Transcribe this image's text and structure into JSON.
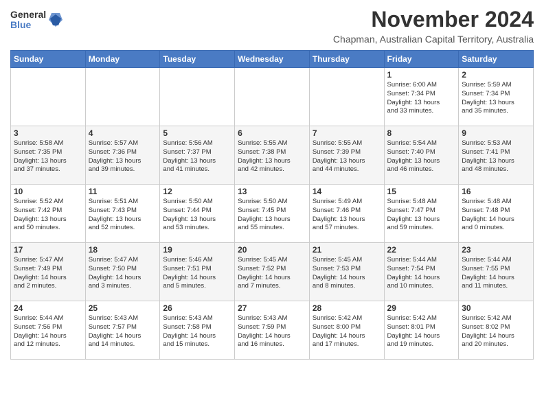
{
  "header": {
    "logo": {
      "general": "General",
      "blue": "Blue"
    },
    "title": "November 2024",
    "subtitle": "Chapman, Australian Capital Territory, Australia"
  },
  "weekdays": [
    "Sunday",
    "Monday",
    "Tuesday",
    "Wednesday",
    "Thursday",
    "Friday",
    "Saturday"
  ],
  "weeks": [
    [
      {
        "day": "",
        "info": ""
      },
      {
        "day": "",
        "info": ""
      },
      {
        "day": "",
        "info": ""
      },
      {
        "day": "",
        "info": ""
      },
      {
        "day": "",
        "info": ""
      },
      {
        "day": "1",
        "info": "Sunrise: 6:00 AM\nSunset: 7:34 PM\nDaylight: 13 hours\nand 33 minutes."
      },
      {
        "day": "2",
        "info": "Sunrise: 5:59 AM\nSunset: 7:34 PM\nDaylight: 13 hours\nand 35 minutes."
      }
    ],
    [
      {
        "day": "3",
        "info": "Sunrise: 5:58 AM\nSunset: 7:35 PM\nDaylight: 13 hours\nand 37 minutes."
      },
      {
        "day": "4",
        "info": "Sunrise: 5:57 AM\nSunset: 7:36 PM\nDaylight: 13 hours\nand 39 minutes."
      },
      {
        "day": "5",
        "info": "Sunrise: 5:56 AM\nSunset: 7:37 PM\nDaylight: 13 hours\nand 41 minutes."
      },
      {
        "day": "6",
        "info": "Sunrise: 5:55 AM\nSunset: 7:38 PM\nDaylight: 13 hours\nand 42 minutes."
      },
      {
        "day": "7",
        "info": "Sunrise: 5:55 AM\nSunset: 7:39 PM\nDaylight: 13 hours\nand 44 minutes."
      },
      {
        "day": "8",
        "info": "Sunrise: 5:54 AM\nSunset: 7:40 PM\nDaylight: 13 hours\nand 46 minutes."
      },
      {
        "day": "9",
        "info": "Sunrise: 5:53 AM\nSunset: 7:41 PM\nDaylight: 13 hours\nand 48 minutes."
      }
    ],
    [
      {
        "day": "10",
        "info": "Sunrise: 5:52 AM\nSunset: 7:42 PM\nDaylight: 13 hours\nand 50 minutes."
      },
      {
        "day": "11",
        "info": "Sunrise: 5:51 AM\nSunset: 7:43 PM\nDaylight: 13 hours\nand 52 minutes."
      },
      {
        "day": "12",
        "info": "Sunrise: 5:50 AM\nSunset: 7:44 PM\nDaylight: 13 hours\nand 53 minutes."
      },
      {
        "day": "13",
        "info": "Sunrise: 5:50 AM\nSunset: 7:45 PM\nDaylight: 13 hours\nand 55 minutes."
      },
      {
        "day": "14",
        "info": "Sunrise: 5:49 AM\nSunset: 7:46 PM\nDaylight: 13 hours\nand 57 minutes."
      },
      {
        "day": "15",
        "info": "Sunrise: 5:48 AM\nSunset: 7:47 PM\nDaylight: 13 hours\nand 59 minutes."
      },
      {
        "day": "16",
        "info": "Sunrise: 5:48 AM\nSunset: 7:48 PM\nDaylight: 14 hours\nand 0 minutes."
      }
    ],
    [
      {
        "day": "17",
        "info": "Sunrise: 5:47 AM\nSunset: 7:49 PM\nDaylight: 14 hours\nand 2 minutes."
      },
      {
        "day": "18",
        "info": "Sunrise: 5:47 AM\nSunset: 7:50 PM\nDaylight: 14 hours\nand 3 minutes."
      },
      {
        "day": "19",
        "info": "Sunrise: 5:46 AM\nSunset: 7:51 PM\nDaylight: 14 hours\nand 5 minutes."
      },
      {
        "day": "20",
        "info": "Sunrise: 5:45 AM\nSunset: 7:52 PM\nDaylight: 14 hours\nand 7 minutes."
      },
      {
        "day": "21",
        "info": "Sunrise: 5:45 AM\nSunset: 7:53 PM\nDaylight: 14 hours\nand 8 minutes."
      },
      {
        "day": "22",
        "info": "Sunrise: 5:44 AM\nSunset: 7:54 PM\nDaylight: 14 hours\nand 10 minutes."
      },
      {
        "day": "23",
        "info": "Sunrise: 5:44 AM\nSunset: 7:55 PM\nDaylight: 14 hours\nand 11 minutes."
      }
    ],
    [
      {
        "day": "24",
        "info": "Sunrise: 5:44 AM\nSunset: 7:56 PM\nDaylight: 14 hours\nand 12 minutes."
      },
      {
        "day": "25",
        "info": "Sunrise: 5:43 AM\nSunset: 7:57 PM\nDaylight: 14 hours\nand 14 minutes."
      },
      {
        "day": "26",
        "info": "Sunrise: 5:43 AM\nSunset: 7:58 PM\nDaylight: 14 hours\nand 15 minutes."
      },
      {
        "day": "27",
        "info": "Sunrise: 5:43 AM\nSunset: 7:59 PM\nDaylight: 14 hours\nand 16 minutes."
      },
      {
        "day": "28",
        "info": "Sunrise: 5:42 AM\nSunset: 8:00 PM\nDaylight: 14 hours\nand 17 minutes."
      },
      {
        "day": "29",
        "info": "Sunrise: 5:42 AM\nSunset: 8:01 PM\nDaylight: 14 hours\nand 19 minutes."
      },
      {
        "day": "30",
        "info": "Sunrise: 5:42 AM\nSunset: 8:02 PM\nDaylight: 14 hours\nand 20 minutes."
      }
    ]
  ]
}
